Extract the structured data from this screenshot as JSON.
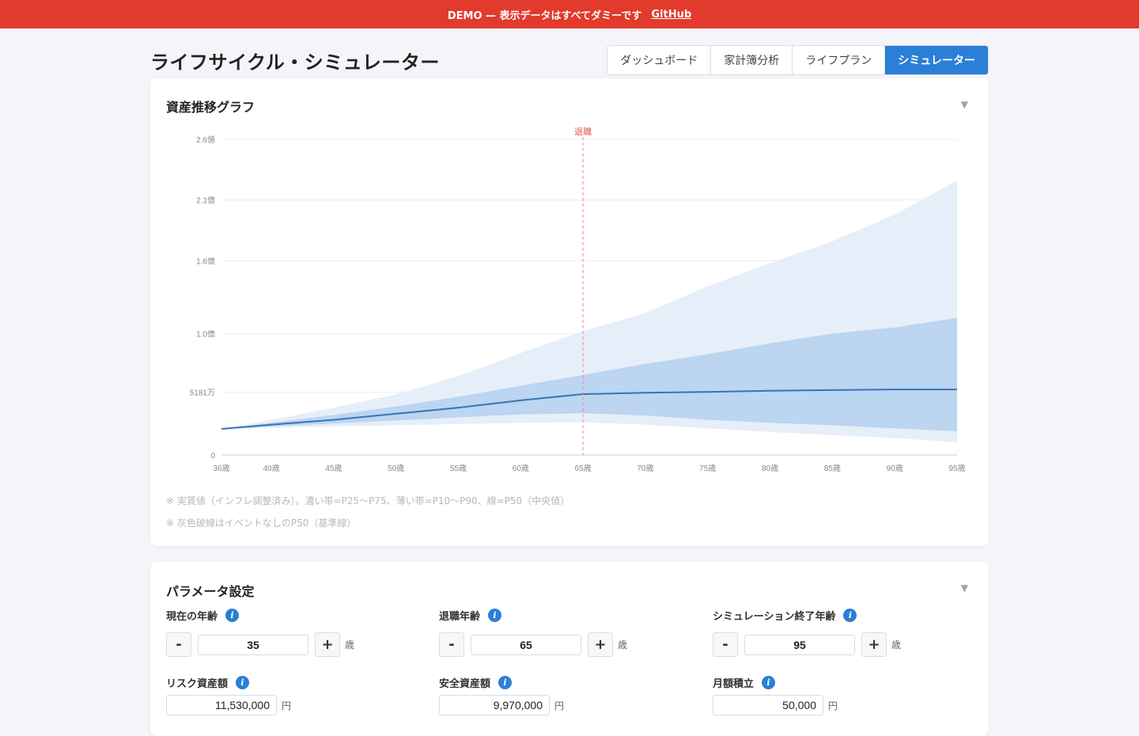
{
  "banner": {
    "text": "DEMO — 表示データはすべてダミーです",
    "link": "GitHub"
  },
  "page_title": "ライフサイクル・シミュレーター",
  "tabs": [
    {
      "label": "ダッシュボード",
      "active": false
    },
    {
      "label": "家計簿分析",
      "active": false
    },
    {
      "label": "ライフプラン",
      "active": false
    },
    {
      "label": "シミュレーター",
      "active": true
    }
  ],
  "colors": {
    "accent": "#2b7fd6",
    "banner": "#e23a2c",
    "median": "#3574b8",
    "band_outer": "#e6eef9",
    "band_inner": "#bcd5f0",
    "retire_line": "#e98f89"
  },
  "graph": {
    "title": "資産推移グラフ",
    "collapse_icon": "▼",
    "notes": [
      "※ 実質値（インフレ調整済み）。濃い帯=P25〜P75、薄い帯=P10〜P90、線=P50（中央値）",
      "※ 灰色破線はイベントなしのP50（基準線）"
    ]
  },
  "chart_data": {
    "type": "area",
    "xlim": [
      36,
      95
    ],
    "ylim": [
      0,
      25000
    ],
    "y_unit": "万円",
    "xticks": [
      {
        "v": 36,
        "label": "36歳"
      },
      {
        "v": 40,
        "label": "40歳"
      },
      {
        "v": 45,
        "label": "45歳"
      },
      {
        "v": 50,
        "label": "50歳"
      },
      {
        "v": 55,
        "label": "55歳"
      },
      {
        "v": 60,
        "label": "60歳"
      },
      {
        "v": 65,
        "label": "65歳"
      },
      {
        "v": 70,
        "label": "70歳"
      },
      {
        "v": 75,
        "label": "75歳"
      },
      {
        "v": 80,
        "label": "80歳"
      },
      {
        "v": 85,
        "label": "85歳"
      },
      {
        "v": 90,
        "label": "90歳"
      },
      {
        "v": 95,
        "label": "95歳"
      }
    ],
    "yticks": [
      {
        "v": 0,
        "label": "0"
      },
      {
        "v": 5181,
        "label": "5181万"
      },
      {
        "v": 10000,
        "label": "1.0億"
      },
      {
        "v": 16000,
        "label": "1.6億"
      },
      {
        "v": 21000,
        "label": "2.1億"
      },
      {
        "v": 26000,
        "label": "2.6億"
      }
    ],
    "grid": true,
    "annotation": {
      "x": 65,
      "label": "退職"
    },
    "x": [
      36,
      40,
      45,
      50,
      55,
      60,
      65,
      70,
      75,
      80,
      85,
      90,
      95
    ],
    "series": [
      {
        "key": "p90",
        "values": [
          2150,
          2900,
          3900,
          5000,
          6500,
          8400,
          10200,
          11700,
          13900,
          15800,
          17600,
          19800,
          22600
        ]
      },
      {
        "key": "p75",
        "values": [
          2150,
          2650,
          3300,
          4000,
          4800,
          5700,
          6600,
          7500,
          8300,
          9200,
          10000,
          10500,
          11300
        ]
      },
      {
        "key": "p50",
        "values": [
          2150,
          2500,
          2900,
          3400,
          3900,
          4500,
          5020,
          5130,
          5200,
          5300,
          5350,
          5400,
          5400
        ]
      },
      {
        "key": "p25",
        "values": [
          2150,
          2350,
          2600,
          2850,
          3100,
          3350,
          3450,
          3250,
          2900,
          2650,
          2450,
          2200,
          1950
        ]
      },
      {
        "key": "p10",
        "values": [
          2150,
          2250,
          2350,
          2450,
          2550,
          2650,
          2700,
          2500,
          2200,
          1900,
          1650,
          1400,
          1050
        ]
      }
    ]
  },
  "params": {
    "title": "パラメータ設定",
    "collapse_icon": "▼",
    "current_age": {
      "label": "現在の年齢",
      "value": "35",
      "unit": "歳"
    },
    "retire_age": {
      "label": "退職年齢",
      "value": "65",
      "unit": "歳"
    },
    "end_age": {
      "label": "シミュレーション終了年齢",
      "value": "95",
      "unit": "歳"
    },
    "risk_assets": {
      "label": "リスク資産額",
      "value": "11,530,000",
      "unit": "円"
    },
    "safe_assets": {
      "label": "安全資産額",
      "value": "9,970,000",
      "unit": "円"
    },
    "monthly": {
      "label": "月額積立",
      "value": "50,000",
      "unit": "円"
    },
    "minus": "-",
    "plus": "+",
    "info_glyph": "i"
  }
}
